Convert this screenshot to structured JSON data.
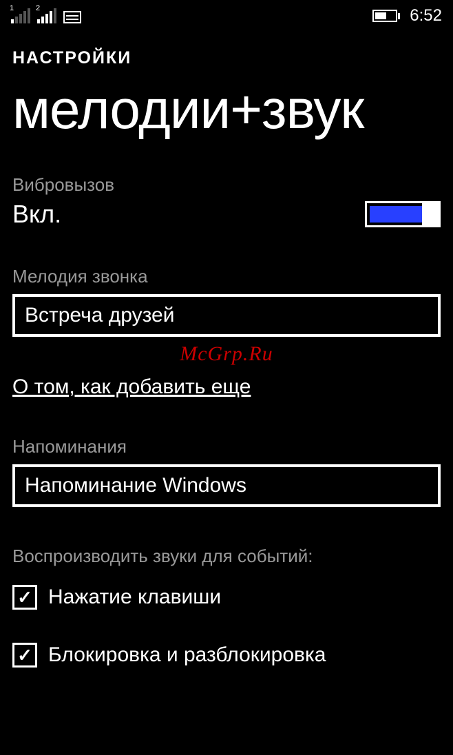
{
  "status": {
    "sim1": "1",
    "sim2": "2",
    "time": "6:52"
  },
  "header": {
    "section": "НАСТРОЙКИ",
    "title": "мелодии+звук"
  },
  "vibrate": {
    "label": "Вибровызов",
    "value": "Вкл."
  },
  "ringtone": {
    "label": "Мелодия звонка",
    "value": "Встреча друзей"
  },
  "watermark": "McGrp.Ru",
  "addMoreLink": "О том, как добавить еще",
  "reminders": {
    "label": "Напоминания",
    "value": "Напоминание Windows"
  },
  "sounds": {
    "label": "Воспроизводить звуки для событий:",
    "items": [
      {
        "label": "Нажатие клавиши",
        "checked": true
      },
      {
        "label": "Блокировка и разблокировка",
        "checked": true
      }
    ]
  }
}
